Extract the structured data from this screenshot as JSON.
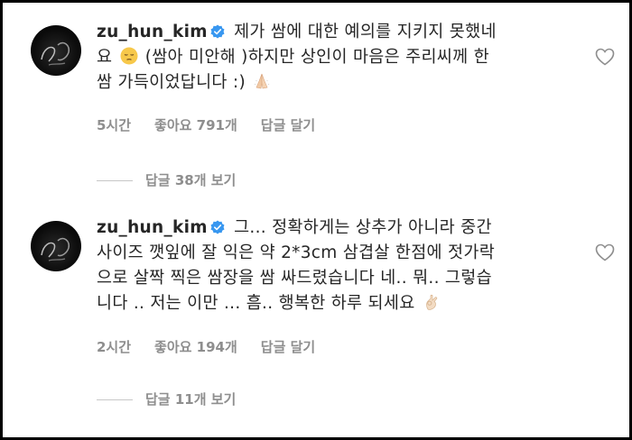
{
  "comments": [
    {
      "username": "zu_hun_kim",
      "text_lines": [
        "제가 쌈에 대한 예의를 지키지 못했네",
        "요",
        "(쌈아 미안해 )하지만 상인이 마음은 주리씨께 한",
        "쌈 가득이었답니다 :)"
      ],
      "emoji_icons": [
        "pensive-face-icon",
        "folded-hands-icon"
      ],
      "time": "5시간",
      "likes": "좋아요 791개",
      "reply_label": "답글 달기",
      "view_replies": "답글 38개 보기"
    },
    {
      "username": "zu_hun_kim",
      "text_lines": [
        "그... 정확하게는 상추가 아니라 중간",
        "사이즈 깻잎에 잘 익은 약 2*3cm 삼겹살 한점에 젓가락",
        "으로 살짝 찍은 쌈장을 쌈 싸드렸습니다 네.. 뭐.. 그렇습",
        "니다 .. 저는 이만 ... 흠.. 행복한 하루 되세요"
      ],
      "emoji_icons": [
        "ok-hand-icon"
      ],
      "time": "2시간",
      "likes": "좋아요 194개",
      "reply_label": "답글 달기",
      "view_replies": "답글 11개 보기"
    }
  ],
  "colors": {
    "verified": "#3897f0",
    "text": "#262626",
    "secondary": "#8e8e8e"
  }
}
